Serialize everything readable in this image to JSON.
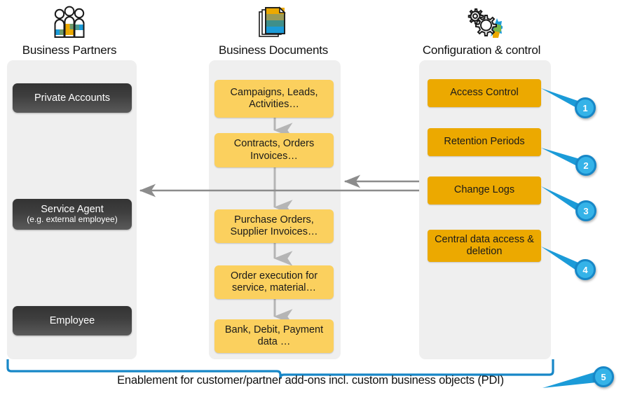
{
  "columns": [
    {
      "id": "business-partners",
      "title": "Business Partners",
      "icon": "people-group-icon",
      "items": [
        {
          "label": "Private Accounts",
          "sub": ""
        },
        {
          "label": "Service Agent",
          "sub": "(e.g. external employee)"
        },
        {
          "label": "Employee",
          "sub": ""
        }
      ]
    },
    {
      "id": "business-documents",
      "title": "Business Documents",
      "icon": "documents-stack-icon",
      "items": [
        {
          "label": "Campaigns, Leads, Activities…"
        },
        {
          "label": "Contracts, Orders Invoices…"
        },
        {
          "label": "Purchase Orders, Supplier Invoices…"
        },
        {
          "label": "Order execution for service, material…"
        },
        {
          "label": "Bank, Debit, Payment data …"
        }
      ]
    },
    {
      "id": "configuration-control",
      "title": "Configuration & control",
      "icon": "gears-icon",
      "items": [
        {
          "label": "Access Control",
          "callout": "1"
        },
        {
          "label": "Retention Periods",
          "callout": "2"
        },
        {
          "label": "Change Logs",
          "callout": "3"
        },
        {
          "label": "Central data access & deletion",
          "callout": "4"
        }
      ]
    }
  ],
  "callouts": [
    {
      "number": "1"
    },
    {
      "number": "2"
    },
    {
      "number": "3"
    },
    {
      "number": "4"
    },
    {
      "number": "5"
    }
  ],
  "footer": {
    "caption": "Enablement for customer/partner add-ons incl.  custom business objects (PDI)",
    "callout": "5"
  },
  "colors": {
    "orange_box": "#eca900",
    "yellow_box": "#fbd05e",
    "dark_box": "#3e3e3e",
    "panel": "#efefef",
    "callout_blue": "#1787c7",
    "callout_blue_light": "#35b3e8",
    "arrow_gray": "#8c8c8c"
  }
}
